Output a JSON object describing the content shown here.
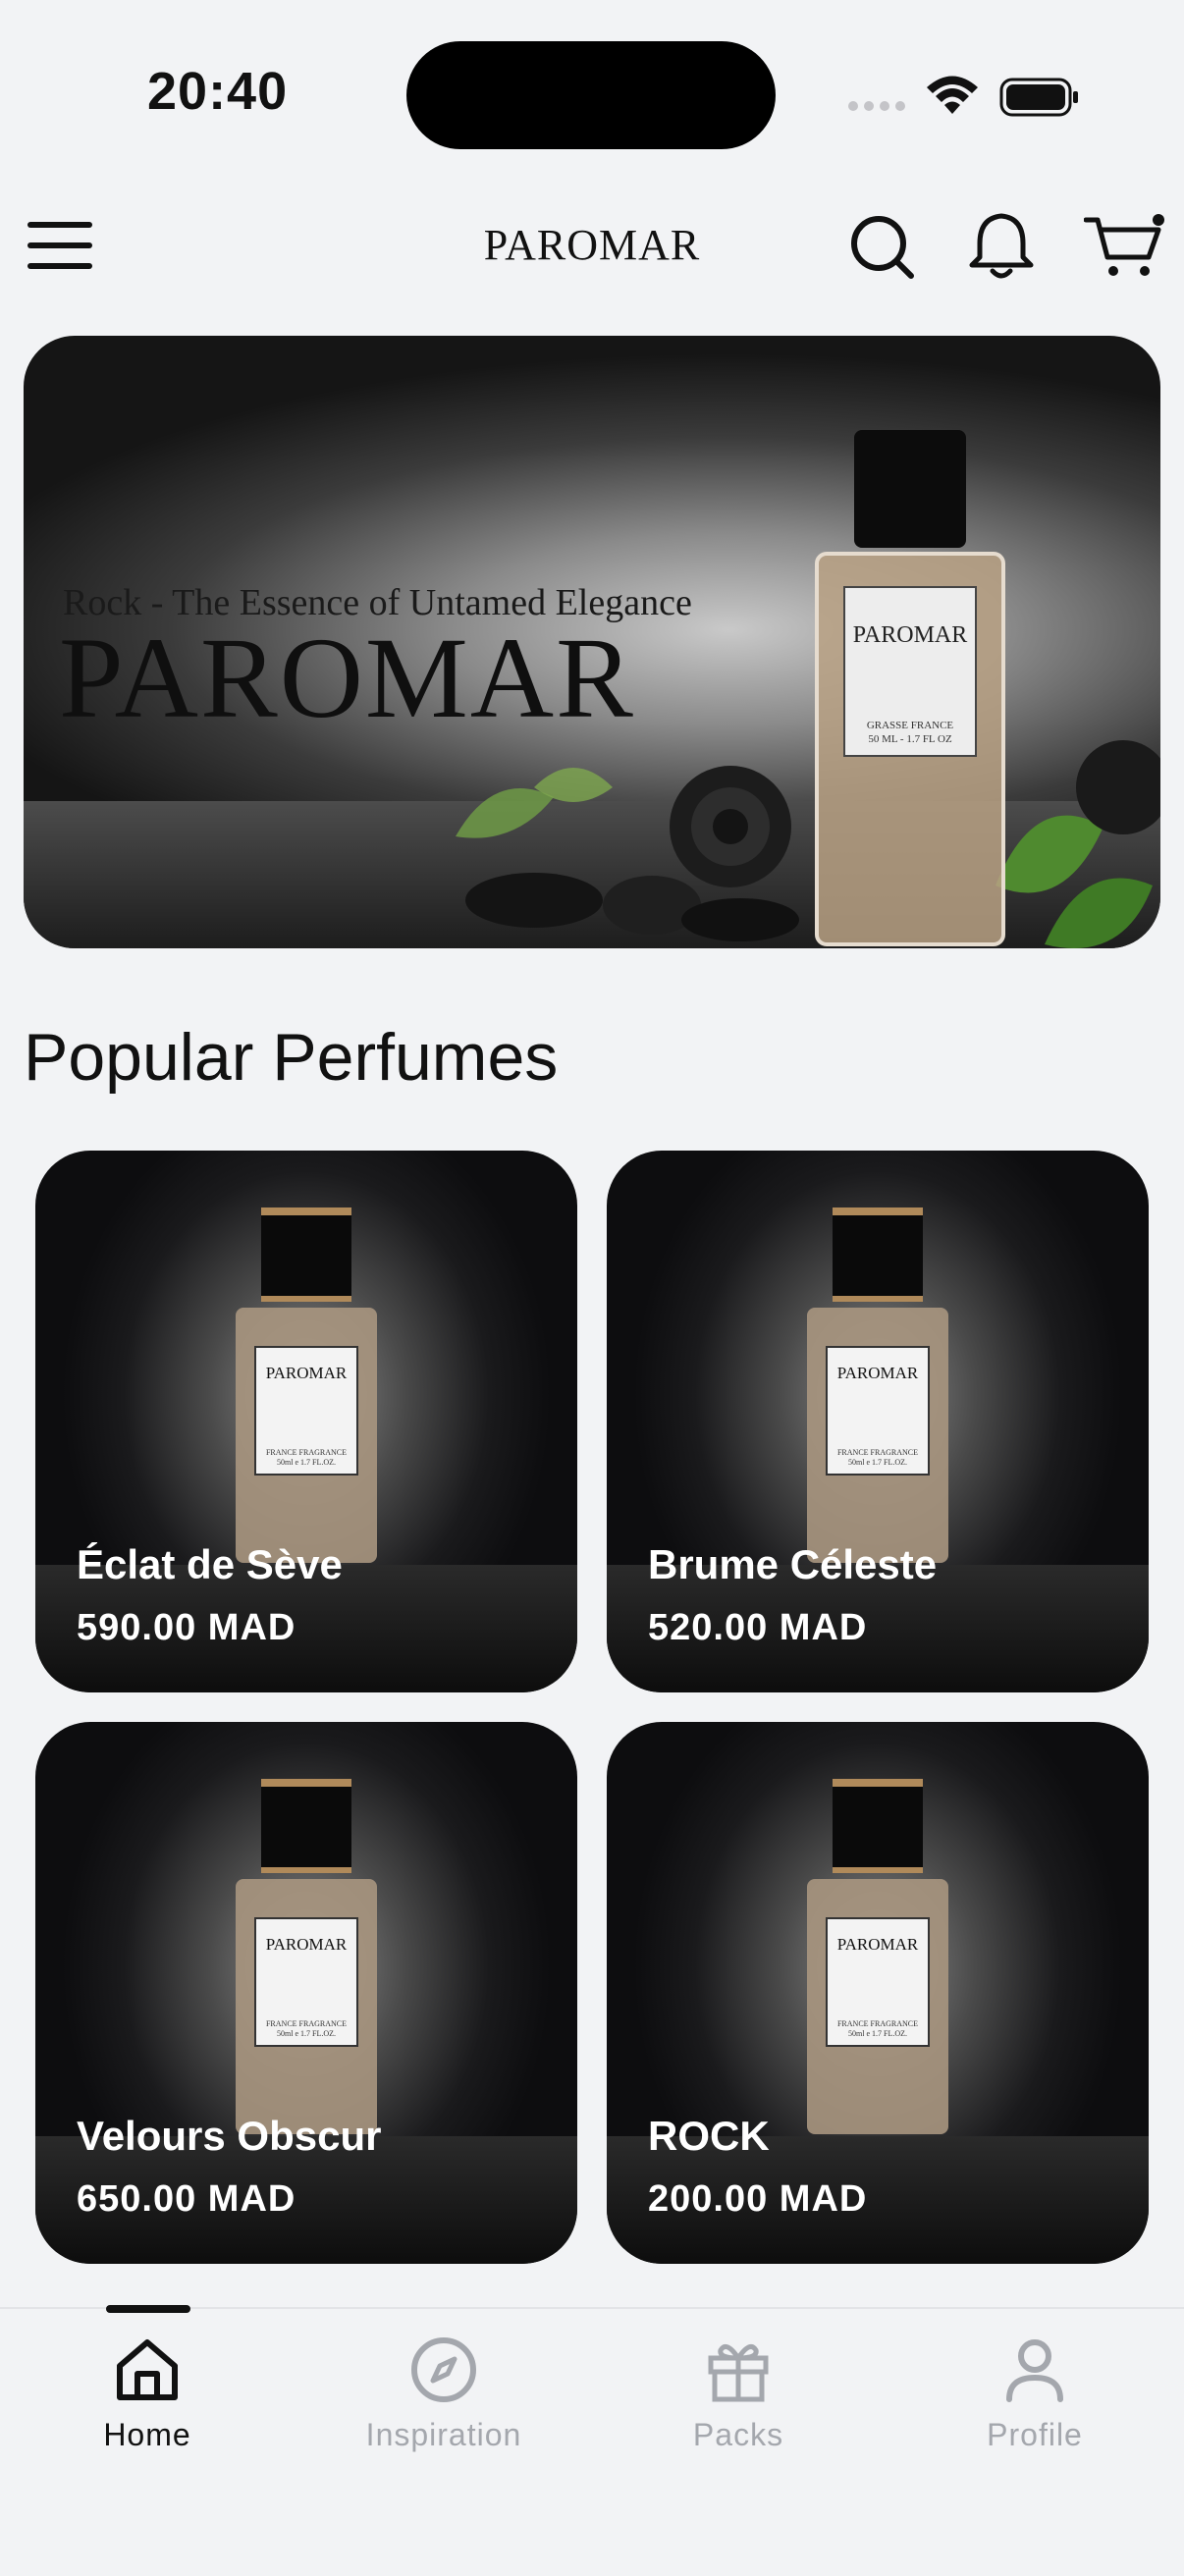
{
  "status_bar": {
    "time": "20:40",
    "icons": [
      "signal-icon",
      "wifi-icon",
      "battery-icon"
    ]
  },
  "app_bar": {
    "brand": "PAROMAR",
    "icons": [
      "menu-icon",
      "search-icon",
      "bell-icon",
      "cart-icon"
    ]
  },
  "hero": {
    "tagline": "Rock - The Essence of Untamed Elegance",
    "title": "PAROMAR",
    "bottle_label": "PAROMAR",
    "bottle_sublabel_1": "GRASSE FRANCE",
    "bottle_sublabel_2": "50 ML - 1.7 FL OZ"
  },
  "section": {
    "title": "Popular Perfumes"
  },
  "products": [
    {
      "name": "Éclat de Sève",
      "price": "590.00 MAD",
      "label": "PAROMAR",
      "sublabel_1": "FRANCE FRAGRANCE",
      "sublabel_2": "50ml e 1.7 FL.OZ."
    },
    {
      "name": "Brume Céleste",
      "price": "520.00 MAD",
      "label": "PAROMAR",
      "sublabel_1": "FRANCE FRAGRANCE",
      "sublabel_2": "50ml e 1.7 FL.OZ."
    },
    {
      "name": "Velours Obscur",
      "price": "650.00 MAD",
      "label": "PAROMAR",
      "sublabel_1": "FRANCE FRAGRANCE",
      "sublabel_2": "50ml e 1.7 FL.OZ."
    },
    {
      "name": "ROCK",
      "price": "200.00 MAD",
      "label": "PAROMAR",
      "sublabel_1": "FRANCE FRAGRANCE",
      "sublabel_2": "50ml e 1.7 FL.OZ."
    }
  ],
  "bottom_nav": {
    "active": "Home",
    "items": [
      {
        "label": "Home",
        "icon": "home-icon"
      },
      {
        "label": "Inspiration",
        "icon": "compass-icon"
      },
      {
        "label": "Packs",
        "icon": "gift-icon"
      },
      {
        "label": "Profile",
        "icon": "person-icon"
      }
    ]
  },
  "colors": {
    "background": "#f2f3f5",
    "text": "#111111",
    "nav_inactive": "#a4a7ad"
  }
}
